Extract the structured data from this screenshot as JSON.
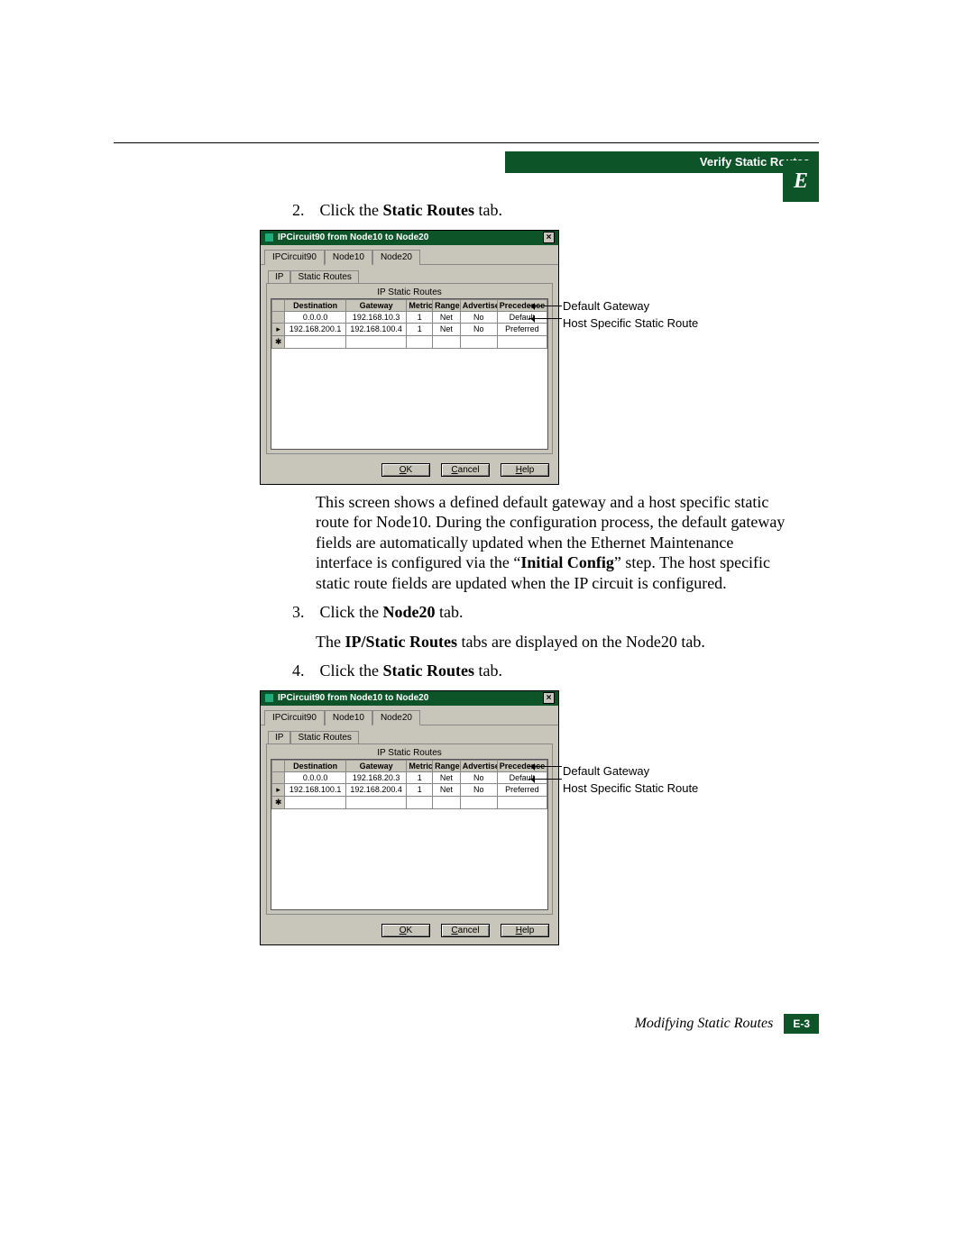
{
  "header": {
    "section": "Verify Static Routes",
    "appendix_letter": "E"
  },
  "steps": {
    "s2_num": "2.",
    "s2_pre": "Click the ",
    "s2_bold": "Static Routes",
    "s2_post": " tab.",
    "s2_explain_a": "This screen shows a defined default gateway and a host specific static route for Node10. During the configuration process, the default gateway fields are automatically updated when the Ethernet Maintenance interface is configured via the “",
    "s2_explain_bold": "Initial Config",
    "s2_explain_b": "” step. The host specific static route fields are updated when the IP circuit is configured.",
    "s3_num": "3.",
    "s3_pre": "Click the ",
    "s3_bold": "Node20",
    "s3_post": " tab.",
    "s3_line2a": "The ",
    "s3_line2bold": "IP/Static Routes",
    "s3_line2b": " tabs are displayed on the Node20 tab.",
    "s4_num": "4.",
    "s4_pre": "Click the ",
    "s4_bold": "Static Routes",
    "s4_post": " tab."
  },
  "dialog": {
    "title": "IPCircuit90 from Node10 to Node20",
    "tabs": [
      "IPCircuit90",
      "Node10",
      "Node20"
    ],
    "subtabs": [
      "IP",
      "Static Routes"
    ],
    "grid_title": "IP Static Routes",
    "columns": [
      "Destination",
      "Gateway",
      "Metric",
      "Range",
      "Advertise",
      "Precedence"
    ],
    "buttons": {
      "ok": "OK",
      "cancel": "Cancel",
      "help": "Help"
    }
  },
  "dlg1": {
    "active_tab_index": 1,
    "rows": [
      {
        "marker": "",
        "dest": "0.0.0.0",
        "gw": "192.168.10.3",
        "metric": "1",
        "range": "Net",
        "adv": "No",
        "prec": "Default"
      },
      {
        "marker": "▸",
        "dest": "192.168.200.1",
        "gw": "192.168.100.4",
        "metric": "1",
        "range": "Net",
        "adv": "No",
        "prec": "Preferred"
      },
      {
        "marker": "✱",
        "dest": "",
        "gw": "",
        "metric": "",
        "range": "",
        "adv": "",
        "prec": ""
      }
    ]
  },
  "dlg2": {
    "active_tab_index": 2,
    "rows": [
      {
        "marker": "",
        "dest": "0.0.0.0",
        "gw": "192.168.20.3",
        "metric": "1",
        "range": "Net",
        "adv": "No",
        "prec": "Default"
      },
      {
        "marker": "▸",
        "dest": "192.168.100.1",
        "gw": "192.168.200.4",
        "metric": "1",
        "range": "Net",
        "adv": "No",
        "prec": "Preferred"
      },
      {
        "marker": "✱",
        "dest": "",
        "gw": "",
        "metric": "",
        "range": "",
        "adv": "",
        "prec": ""
      }
    ]
  },
  "callouts": {
    "c1": "Default Gateway",
    "c2": "Host Specific Static Route"
  },
  "footer": {
    "title": "Modifying Static Routes",
    "page": "E-3"
  }
}
